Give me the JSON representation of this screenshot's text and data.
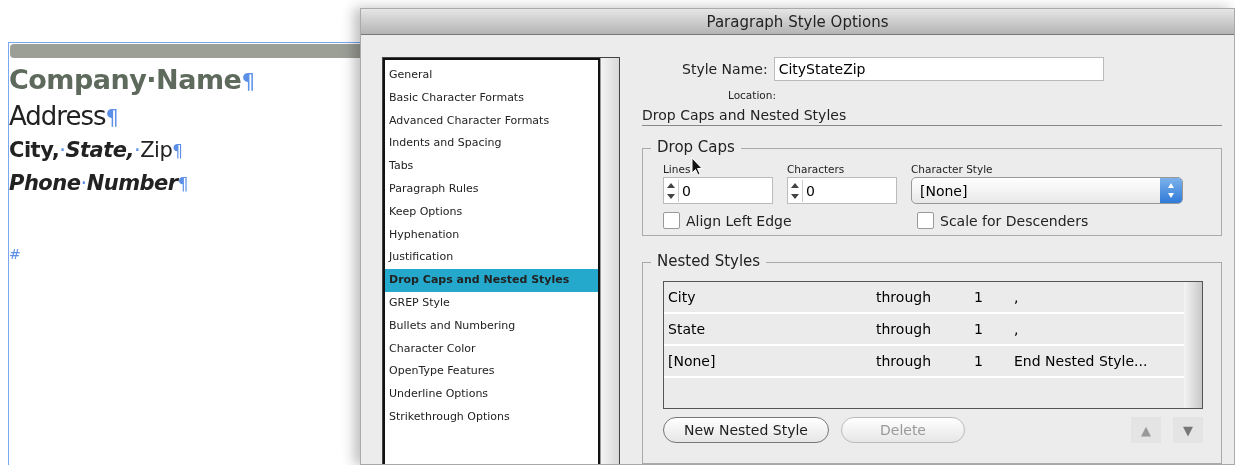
{
  "document": {
    "lines": [
      {
        "kind": "heading",
        "segments": [
          {
            "text": "Company·Name",
            "kind": "bold"
          }
        ],
        "mark": "¶"
      },
      {
        "kind": "body",
        "segments": [
          {
            "text": "Address",
            "kind": "plain"
          }
        ],
        "mark": "¶"
      },
      {
        "kind": "sub",
        "segments": [
          {
            "text": "City,",
            "kind": "bold"
          },
          {
            "text": "·",
            "kind": "dot"
          },
          {
            "text": "State,",
            "kind": "bolditalic"
          },
          {
            "text": "·",
            "kind": "dot"
          },
          {
            "text": "Zip",
            "kind": "plain"
          }
        ],
        "mark": "¶"
      },
      {
        "kind": "sub",
        "segments": [
          {
            "text": "Phone",
            "kind": "bolditalic"
          },
          {
            "text": "·",
            "kind": "dot"
          },
          {
            "text": "Number",
            "kind": "bolditalic"
          }
        ],
        "mark": "¶"
      }
    ],
    "end_mark": "#"
  },
  "dialog": {
    "title": "Paragraph Style Options",
    "categories": [
      {
        "label": "General",
        "selected": false
      },
      {
        "label": "Basic Character Formats",
        "selected": false
      },
      {
        "label": "Advanced Character Formats",
        "selected": false
      },
      {
        "label": "Indents and Spacing",
        "selected": false
      },
      {
        "label": "Tabs",
        "selected": false
      },
      {
        "label": "Paragraph Rules",
        "selected": false
      },
      {
        "label": "Keep Options",
        "selected": false
      },
      {
        "label": "Hyphenation",
        "selected": false
      },
      {
        "label": "Justification",
        "selected": false
      },
      {
        "label": "Drop Caps and Nested Styles",
        "selected": true
      },
      {
        "label": "GREP Style",
        "selected": false
      },
      {
        "label": "Bullets and Numbering",
        "selected": false
      },
      {
        "label": "Character Color",
        "selected": false
      },
      {
        "label": "OpenType Features",
        "selected": false
      },
      {
        "label": "Underline Options",
        "selected": false
      },
      {
        "label": "Strikethrough Options",
        "selected": false
      }
    ],
    "style_name": {
      "label": "Style Name:",
      "value": "CityStateZip"
    },
    "location_label": "Location:",
    "section_title": "Drop Caps and Nested Styles",
    "drop_caps": {
      "title": "Drop Caps",
      "lines": {
        "label": "Lines",
        "value": "0"
      },
      "characters": {
        "label": "Characters",
        "value": "0"
      },
      "character_style": {
        "label": "Character Style",
        "value": "[None]"
      },
      "checkboxes": [
        {
          "label": "Align Left Edge",
          "checked": false
        },
        {
          "label": "Scale for Descenders",
          "checked": false
        }
      ]
    },
    "nested_styles": {
      "title": "Nested Styles",
      "rows": [
        {
          "style": "City",
          "mode": "through",
          "count": "1",
          "until": ","
        },
        {
          "style": "State",
          "mode": "through",
          "count": "1",
          "until": ","
        },
        {
          "style": "[None]",
          "mode": "through",
          "count": "1",
          "until": "End Nested Style..."
        }
      ],
      "buttons": [
        {
          "label": "New Nested Style",
          "disabled": false
        },
        {
          "label": "Delete",
          "disabled": true
        }
      ],
      "move_up": "▲",
      "move_down": "▼"
    }
  }
}
